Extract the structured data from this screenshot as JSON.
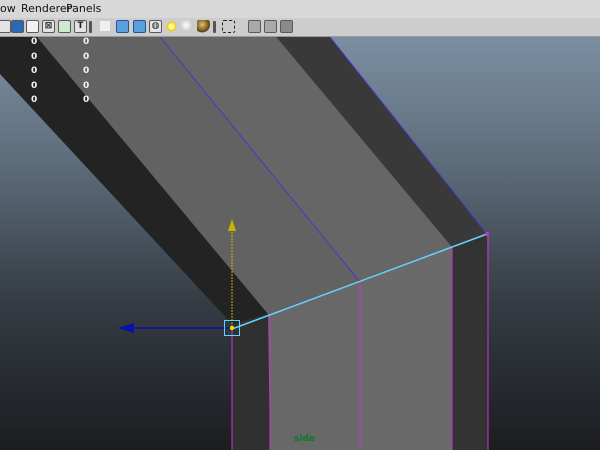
{
  "menubar": {
    "items": [
      {
        "label": "ow"
      },
      {
        "label": "Renderer"
      },
      {
        "label": "Panels"
      }
    ]
  },
  "toolbar": {
    "buttons": [
      {
        "icon": "select-camera-icon"
      },
      {
        "icon": "camera-attributes-icon"
      },
      {
        "icon": "image-plane-icon"
      },
      {
        "icon": "grid-icon"
      },
      {
        "icon": "film-gate-icon"
      },
      {
        "icon": "title-safe-icon",
        "glyph": "T"
      },
      {
        "icon": "wireframe-icon",
        "active": true
      },
      {
        "icon": "smooth-shade-icon",
        "active": true
      },
      {
        "icon": "shaded-wireframe-icon"
      },
      {
        "icon": "default-lighting-icon"
      },
      {
        "icon": "all-lights-icon"
      },
      {
        "icon": "flat-lighting-icon"
      },
      {
        "icon": "isolate-select-icon"
      },
      {
        "icon": "xray-icon"
      },
      {
        "icon": "xray-joints-icon"
      },
      {
        "icon": "backface-culling-icon"
      }
    ]
  },
  "hud": {
    "rows": [
      {
        "a": "0",
        "b": "0"
      },
      {
        "a": "0",
        "b": "0"
      },
      {
        "a": "0",
        "b": "0"
      },
      {
        "a": "0",
        "b": "0"
      },
      {
        "a": "0",
        "b": "0"
      }
    ]
  },
  "viewport": {
    "camera_label": "side"
  },
  "colors": {
    "top_face": "#616161",
    "side_face": "#2c2c2c",
    "edge_highlight": "#d030d0",
    "selected_edge": "#5fd6ff",
    "manipulator_y": "#c8b400",
    "manipulator_z": "#0b10a8",
    "camera_label": "#0a7a2a"
  }
}
